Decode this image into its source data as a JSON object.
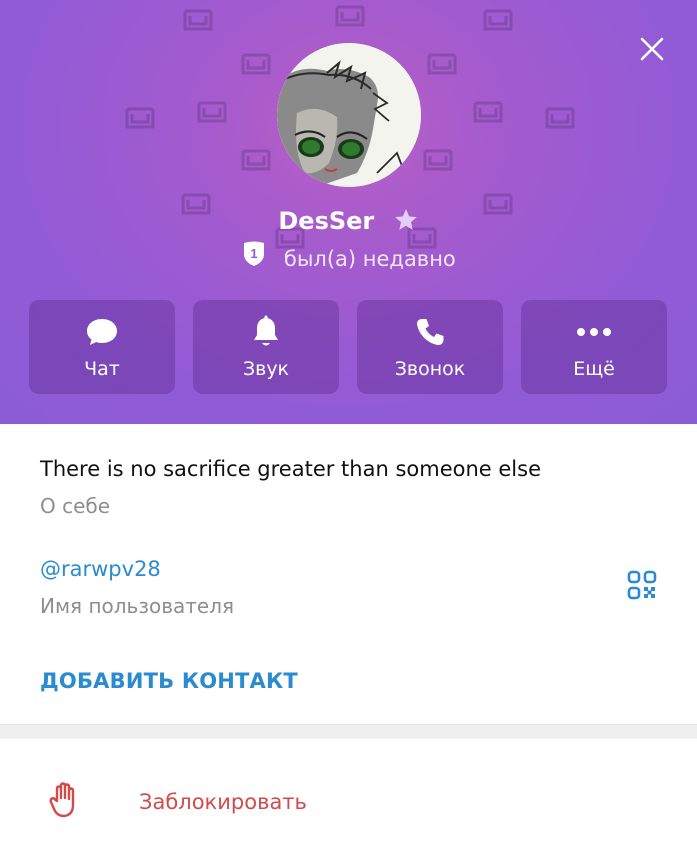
{
  "profile": {
    "name": "DesSer",
    "status": "был(а) недавно",
    "badge_number": "1"
  },
  "actions": [
    {
      "label": "Чат",
      "icon": "chat-bubble-icon"
    },
    {
      "label": "Звук",
      "icon": "bell-icon"
    },
    {
      "label": "Звонок",
      "icon": "phone-icon"
    },
    {
      "label": "Ещё",
      "icon": "more-dots-icon"
    }
  ],
  "info": {
    "bio": "There is no sacrifice greater than someone else",
    "bio_caption": "О себе",
    "username": "@rarwpv28",
    "username_caption": "Имя пользователя",
    "add_contact": "ДОБАВИТЬ КОНТАКТ"
  },
  "block": {
    "label": "Заблокировать"
  },
  "colors": {
    "header_purple": "#915bd6",
    "link_blue": "#2a8bd0",
    "danger_red": "#d14b4b"
  }
}
